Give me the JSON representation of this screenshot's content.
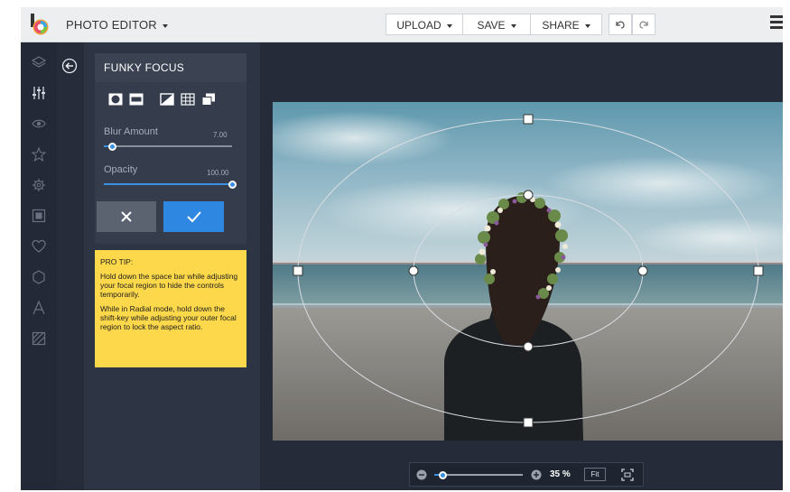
{
  "header": {
    "app_title": "PHOTO EDITOR",
    "upload_label": "UPLOAD",
    "save_label": "SAVE",
    "share_label": "SHARE",
    "undo_icon": "undo-icon",
    "redo_icon": "redo-icon",
    "menu_icon": "hamburger-menu-icon"
  },
  "rail": {
    "tools": [
      "layers-icon",
      "adjust-sliders-icon",
      "eye-icon",
      "star-icon",
      "gear-icon",
      "frame-icon",
      "heart-icon",
      "shape-icon",
      "text-icon",
      "texture-icon"
    ],
    "active_index": 1
  },
  "panel": {
    "back_icon": "back-arrow-icon",
    "title": "FUNKY FOCUS",
    "shapes": [
      "radial-focus-icon",
      "linear-focus-icon",
      "mirrored-focus-icon",
      "grid-icon",
      "stack-icon"
    ],
    "selected_shape_index": 0,
    "blur": {
      "label": "Blur Amount",
      "value": "7.00",
      "level": 0.07
    },
    "opacity": {
      "label": "Opacity",
      "value": "100.00",
      "level": 1.0
    },
    "cancel_icon": "close-icon",
    "apply_icon": "check-icon"
  },
  "tip": {
    "heading": "PRO TIP:",
    "text1": "Hold down the space bar while adjusting your focal region to hide the controls temporarily.",
    "text2": "While in Radial mode, hold down the shift-key while adjusting your outer focal region to lock the aspect ratio."
  },
  "zoom": {
    "minus_icon": "zoom-out-icon",
    "plus_icon": "zoom-in-icon",
    "value": "35 %",
    "level": 0.1,
    "fit_label": "Fit",
    "fullscreen_icon": "fullscreen-icon"
  },
  "colors": {
    "accent": "#2e87e0",
    "tip_background": "#fcd84a",
    "panel_background": "#2d3444",
    "workspace_background": "#252b38"
  }
}
